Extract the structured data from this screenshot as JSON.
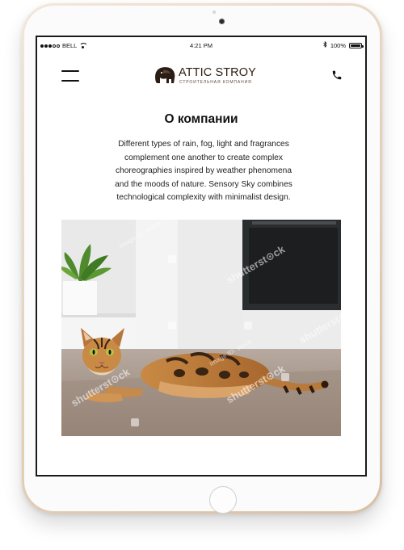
{
  "status_bar": {
    "carrier": "BELL",
    "time": "4:21 PM",
    "battery": "100%",
    "battery_level": 1.0,
    "icons": [
      "signal-icon",
      "wifi-icon",
      "bluetooth-icon",
      "battery-icon"
    ]
  },
  "header": {
    "menu_icon": "hamburger-menu-icon",
    "logo": {
      "title": "ATTIC STROY",
      "subtitle": "СТРОИТЕЛЬНАЯ КОМПАНИЯ",
      "icon": "elephant-logo-icon",
      "color": "#2b1d14"
    },
    "phone_icon": "phone-icon"
  },
  "main": {
    "title": "О компании",
    "text": "Different types of rain, fog, light and fragrances complement one another to create complex choreographies inspired by weather phenomena and the moods of nature. Sensory Sky combines technological complexity with minimalist design.",
    "image": {
      "subject": "cat-photo",
      "watermark": "shutterstock"
    }
  },
  "device": {
    "frame_color": "#e8d5c0",
    "home_button": "home-button"
  }
}
